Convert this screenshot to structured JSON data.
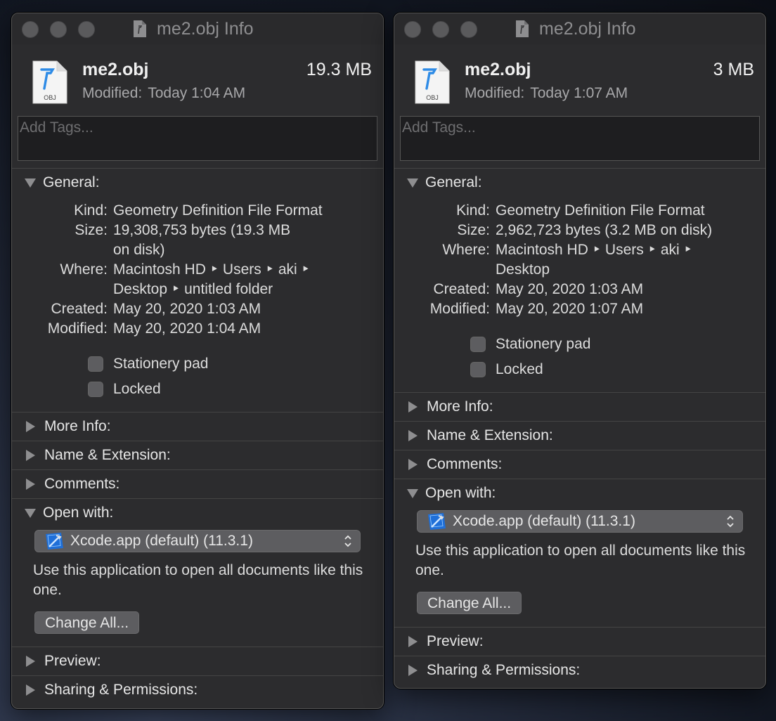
{
  "windows": [
    {
      "title": "me2.obj Info",
      "file_name": "me2.obj",
      "file_size": "19.3 MB",
      "modified_label": "Modified:",
      "modified_value": "Today 1:04 AM",
      "icon_label": "OBJ",
      "tags_placeholder": "Add Tags...",
      "general_label": "General:",
      "kind_label": "Kind:",
      "kind_value": "Geometry Definition File Format",
      "size_label": "Size:",
      "size_value_1": "19,308,753 bytes (19.3 MB",
      "size_value_2": "on disk)",
      "where_label": "Where:",
      "where_value_1": "Macintosh HD ‣ Users ‣ aki ‣",
      "where_value_2": "Desktop ‣ untitled folder",
      "created_label": "Created:",
      "created_value": "May 20, 2020 1:03 AM",
      "modified2_label": "Modified:",
      "modified2_value": "May 20, 2020 1:04 AM",
      "stationery_label": "Stationery pad",
      "locked_label": "Locked",
      "more_info": "More Info:",
      "name_ext": "Name & Extension:",
      "comments": "Comments:",
      "open_with": "Open with:",
      "app_selected": "Xcode.app (default) (11.3.1)",
      "open_with_desc": "Use this application to open all documents like this one.",
      "change_all": "Change All...",
      "preview": "Preview:",
      "sharing": "Sharing & Permissions:"
    },
    {
      "title": "me2.obj Info",
      "file_name": "me2.obj",
      "file_size": "3 MB",
      "modified_label": "Modified:",
      "modified_value": "Today 1:07 AM",
      "icon_label": "OBJ",
      "tags_placeholder": "Add Tags...",
      "general_label": "General:",
      "kind_label": "Kind:",
      "kind_value": "Geometry Definition File Format",
      "size_label": "Size:",
      "size_value_1": "2,962,723 bytes (3.2 MB on disk)",
      "where_label": "Where:",
      "where_value_1": "Macintosh HD ‣ Users ‣ aki ‣",
      "where_value_2": "Desktop",
      "created_label": "Created:",
      "created_value": "May 20, 2020 1:03 AM",
      "modified2_label": "Modified:",
      "modified2_value": "May 20, 2020 1:07 AM",
      "stationery_label": "Stationery pad",
      "locked_label": "Locked",
      "more_info": "More Info:",
      "name_ext": "Name & Extension:",
      "comments": "Comments:",
      "open_with": "Open with:",
      "app_selected": "Xcode.app (default) (11.3.1)",
      "open_with_desc": "Use this application to open all documents like this one.",
      "change_all": "Change All...",
      "preview": "Preview:",
      "sharing": "Sharing & Permissions:"
    }
  ],
  "icons": {
    "file": "obj-file-icon",
    "app": "xcode-icon",
    "traffic_lights": [
      "close",
      "minimize",
      "zoom"
    ]
  }
}
